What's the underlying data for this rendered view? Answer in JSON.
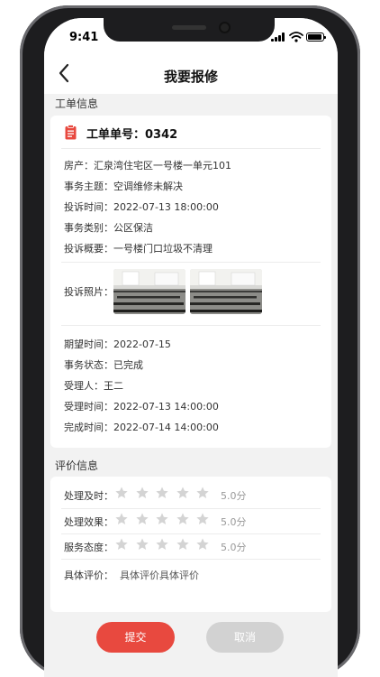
{
  "status_bar": {
    "time": "9:41"
  },
  "nav": {
    "title": "我要报修"
  },
  "work_order": {
    "section_title": "工单信息",
    "order_label": "工单单号：0342",
    "fields_top": [
      {
        "label": "房产：",
        "value": "汇泉湾住宅区一号楼一单元101"
      },
      {
        "label": "事务主题：",
        "value": "空调维修未解决"
      },
      {
        "label": "投诉时间：",
        "value": "2022-07-13 18:00:00"
      },
      {
        "label": "事务类别：",
        "value": "公区保洁"
      },
      {
        "label": "投诉概要：",
        "value": "一号楼门口垃圾不清理"
      }
    ],
    "photos_label": "投诉照片：",
    "fields_bottom": [
      {
        "label": "期望时间：",
        "value": "2022-07-15"
      },
      {
        "label": "事务状态：",
        "value": "已完成"
      },
      {
        "label": "受理人：",
        "value": "王二"
      },
      {
        "label": "受理时间：",
        "value": "2022-07-13 14:00:00"
      },
      {
        "label": "完成时间：",
        "value": "2022-07-14 14:00:00"
      }
    ]
  },
  "evaluation": {
    "section_title": "评价信息",
    "ratings": [
      {
        "label": "处理及时：",
        "score": "5.0分",
        "stars": 5
      },
      {
        "label": "处理效果：",
        "score": "5.0分",
        "stars": 5
      },
      {
        "label": "服务态度：",
        "score": "5.0分",
        "stars": 5
      }
    ],
    "comment_label": "具体评价：",
    "comment_text": "具体评价具体评价"
  },
  "actions": {
    "submit": "提交",
    "cancel": "取消"
  },
  "colors": {
    "accent": "#e8493f",
    "star": "#d4d4d4",
    "disabled": "#d2d2d2"
  }
}
